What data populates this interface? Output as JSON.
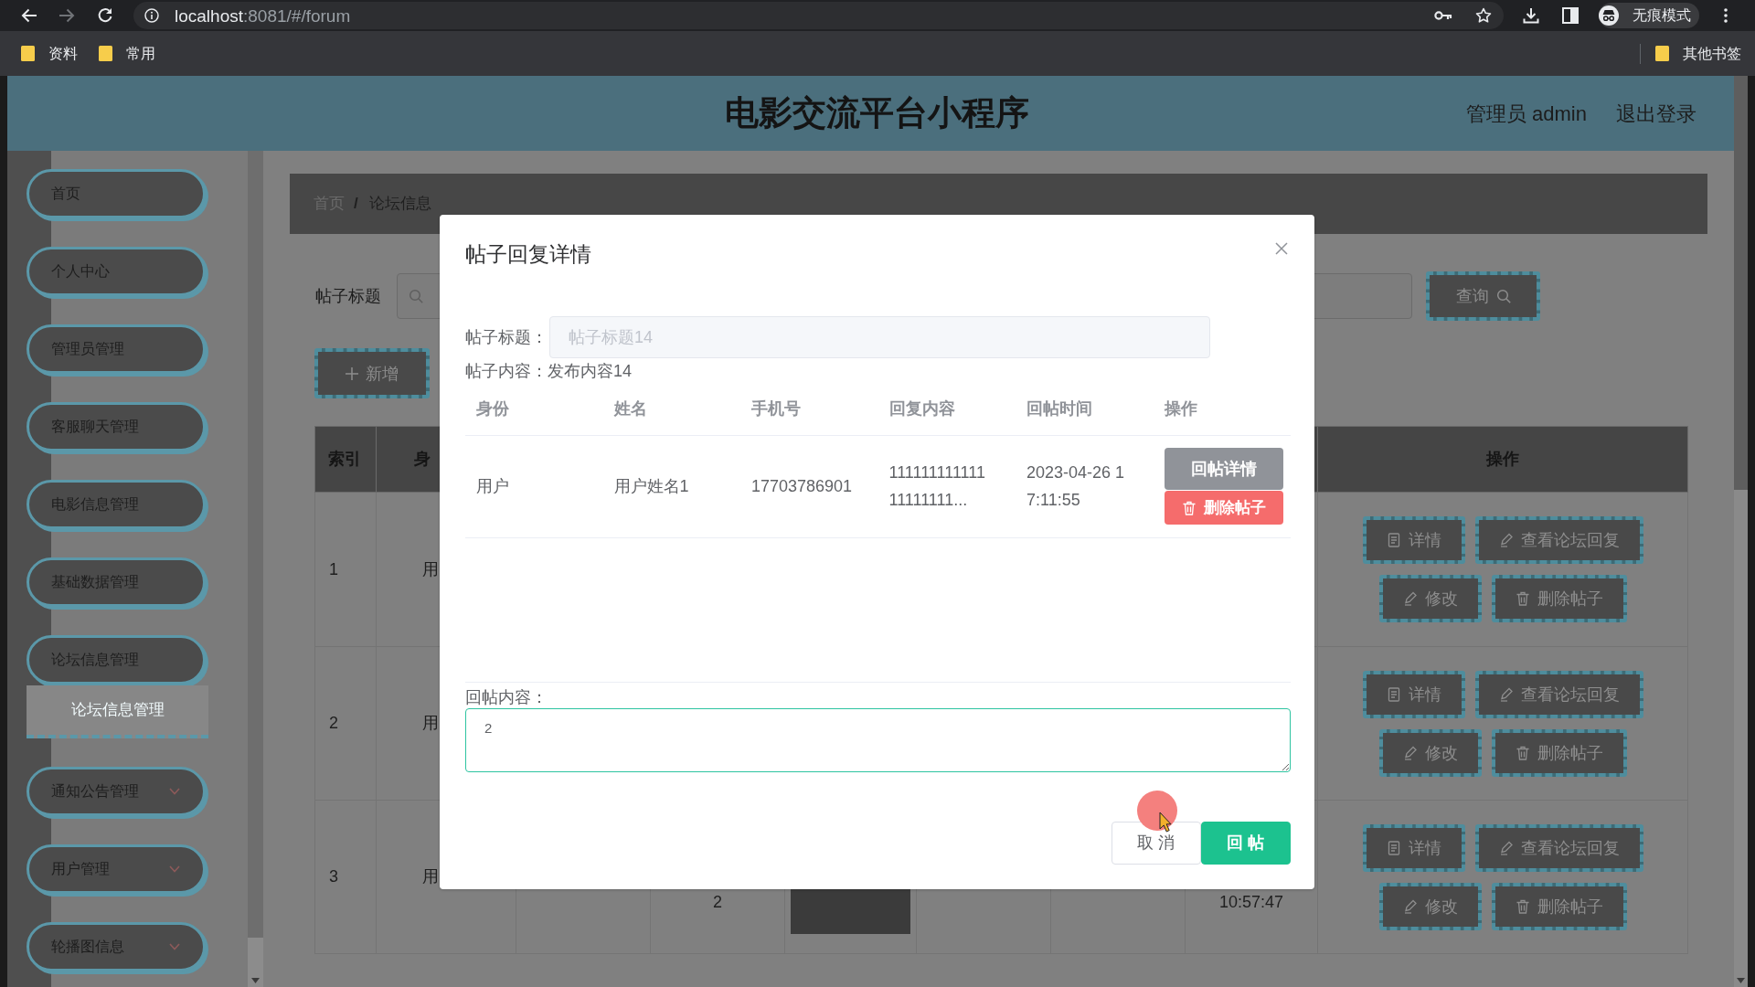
{
  "browser": {
    "url_host": "localhost",
    "url_path": ":8081/#/forum",
    "profile": "无痕模式",
    "bookmarks": [
      {
        "label": "资料"
      },
      {
        "label": "常用"
      }
    ],
    "other_bookmarks": "其他书签"
  },
  "header": {
    "title": "电影交流平台小程序",
    "user": "管理员 admin",
    "logout": "退出登录"
  },
  "sidebar": {
    "items": [
      {
        "label": "首页",
        "has_arrow": false
      },
      {
        "label": "个人中心",
        "has_arrow": false
      },
      {
        "label": "管理员管理",
        "has_arrow": false
      },
      {
        "label": "客服聊天管理",
        "has_arrow": false
      },
      {
        "label": "电影信息管理",
        "has_arrow": false
      },
      {
        "label": "基础数据管理",
        "has_arrow": false
      },
      {
        "label": "论坛信息管理",
        "has_arrow": false,
        "children": [
          {
            "label": "论坛信息管理",
            "selected": true
          }
        ]
      },
      {
        "label": "通知公告管理",
        "has_arrow": true
      },
      {
        "label": "用户管理",
        "has_arrow": true
      },
      {
        "label": "轮播图信息",
        "has_arrow": true
      }
    ]
  },
  "breadcrumb": {
    "separator": "/",
    "items": [
      {
        "label": "首页",
        "selected": false
      },
      {
        "label": "论坛信息",
        "selected": true
      }
    ]
  },
  "search": {
    "label": "帖子标题",
    "button": "查询"
  },
  "add_button": "新增",
  "table": {
    "columns": [
      {
        "label": "索引"
      },
      {
        "label": "身"
      }
    ],
    "actions_column": "操作",
    "rows": [
      {
        "column_1": "1",
        "column_2": "用",
        "actions": [
          {
            "label": "详情",
            "kind": "details"
          },
          {
            "label": "查看论坛回复",
            "kind": "replies"
          },
          {
            "label": "修改",
            "kind": "edit"
          },
          {
            "label": "删除帖子",
            "kind": "delete"
          }
        ]
      },
      {
        "column_1": "2",
        "column_2": "用",
        "actions": [
          {
            "label": "详情",
            "kind": "details"
          },
          {
            "label": "查看论坛回复",
            "kind": "replies"
          },
          {
            "label": "修改",
            "kind": "edit"
          },
          {
            "label": "删除帖子",
            "kind": "delete"
          }
        ]
      },
      {
        "column_1": "3",
        "column_2": "用",
        "column_4": "2",
        "photo": true,
        "column_8": "10:57:47",
        "actions": [
          {
            "label": "详情",
            "kind": "details"
          },
          {
            "label": "查看论坛回复",
            "kind": "replies"
          },
          {
            "label": "修改",
            "kind": "edit"
          },
          {
            "label": "删除帖子",
            "kind": "delete"
          }
        ]
      }
    ]
  },
  "dialog": {
    "title": "帖子回复详情",
    "post_title": {
      "label": "帖子标题：",
      "value": "帖子标题14",
      "disabled": true
    },
    "post_content": {
      "label": "帖子内容：",
      "value": "发布内容14"
    },
    "replies": {
      "columns": [
        "身份",
        "姓名",
        "手机号",
        "回复内容",
        "回帖时间",
        "操作"
      ],
      "rows": [
        {
          "identity": "用户",
          "name": "用户姓名1",
          "phone": "17703786901",
          "content": "11111111111111111111...",
          "time": "2023-04-26 17:11:55",
          "actions": [
            {
              "label": "回帖详情",
              "kind": "detail"
            },
            {
              "label": "删除帖子",
              "kind": "delete"
            }
          ]
        }
      ]
    },
    "reply": {
      "label": "回帖内容：",
      "value": "2"
    },
    "buttons": [
      {
        "label": "取 消",
        "kind": "cancel"
      },
      {
        "label": "回 帖",
        "kind": "primary"
      }
    ]
  }
}
